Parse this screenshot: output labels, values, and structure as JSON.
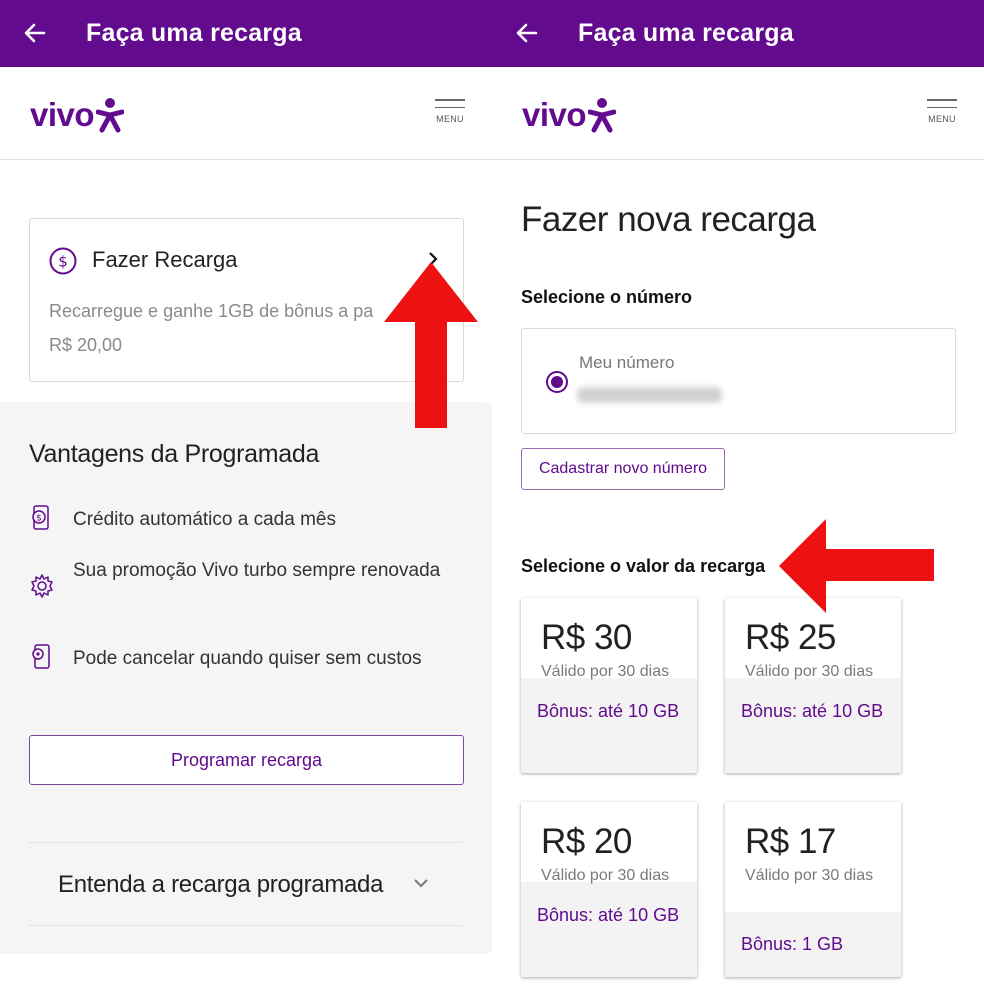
{
  "left_screen": {
    "appbar": {
      "back_icon": "arrow-left-icon",
      "title": "Faça uma recarga"
    },
    "header": {
      "logo": "vivo",
      "menu_label": "MENU"
    },
    "recharge_card": {
      "icon": "dollar-circle-icon",
      "title": "Fazer Recarga",
      "description": "Recarregue e ganhe 1GB de bônus a pa",
      "price": "R$ 20,00"
    },
    "advantages": {
      "title": "Vantagens da Programada",
      "items": [
        {
          "icon": "phone-dollar-icon",
          "label": "Crédito automático a cada mês"
        },
        {
          "icon": "gear-icon",
          "label": "Sua promoção Vivo turbo sempre renovada"
        },
        {
          "icon": "phone-settings-icon",
          "label": "Pode cancelar quando quiser sem custos"
        }
      ],
      "button_label": "Programar recarga",
      "accordion_label": "Entenda a recarga programada"
    }
  },
  "right_screen": {
    "appbar": {
      "back_icon": "arrow-left-icon",
      "title": "Faça uma recarga"
    },
    "header": {
      "logo": "vivo",
      "menu_label": "MENU"
    },
    "page_title": "Fazer nova recarga",
    "select_number_label": "Selecione o número",
    "number_option": {
      "label": "Meu número",
      "selected": true
    },
    "register_button": "Cadastrar novo número",
    "select_value_label": "Selecione o valor da recarga",
    "values": [
      {
        "amount": "R$ 30",
        "validity": "Válido por 30 dias",
        "bonus": "Bônus: até 10 GB"
      },
      {
        "amount": "R$ 25",
        "validity": "Válido por 30 dias",
        "bonus": "Bônus: até 10 GB"
      },
      {
        "amount": "R$ 20",
        "validity": "Válido por 30 dias",
        "bonus": "Bônus: até 10 GB"
      },
      {
        "amount": "R$ 17",
        "validity": "Válido por 30 dias",
        "bonus": "Bônus: 1 GB"
      }
    ]
  },
  "colors": {
    "brand_purple": "#620b8f",
    "annotation_red": "#ee1111"
  }
}
